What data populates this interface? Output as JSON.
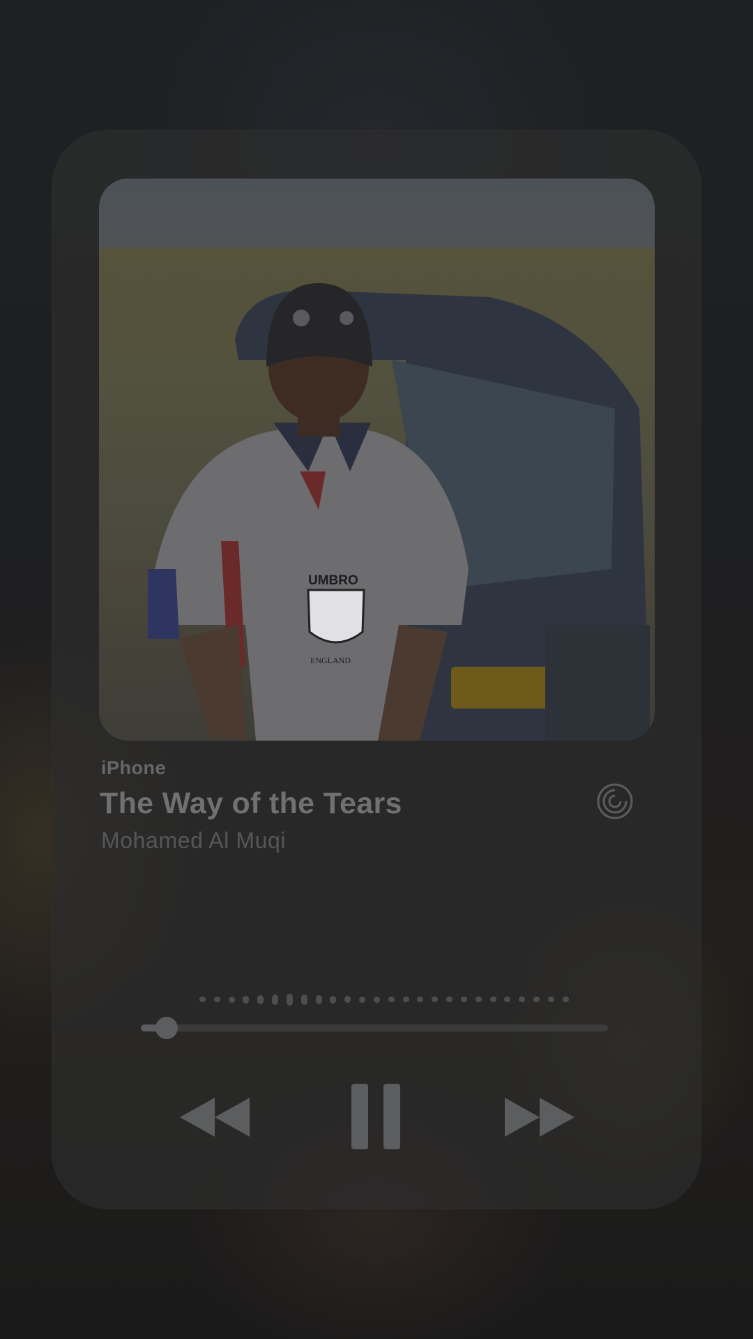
{
  "player": {
    "source_label": "iPhone",
    "track_title": "The Way of the Tears",
    "artist": "Mohamed Al Muqi",
    "progress_fraction": 0.055,
    "state": "playing",
    "artwork_text": {
      "shirt_brand": "UMBRO",
      "crest_caption": "ENGLAND"
    }
  },
  "icons": {
    "airplay": "airplay-icon",
    "rewind": "rewind-icon",
    "pause": "pause-icon",
    "forward": "fast-forward-icon"
  },
  "colors": {
    "card_background": "#2c2c2c",
    "primary_text": "#6f7072",
    "secondary_text": "#55575a",
    "control": "#5c5d5f"
  }
}
